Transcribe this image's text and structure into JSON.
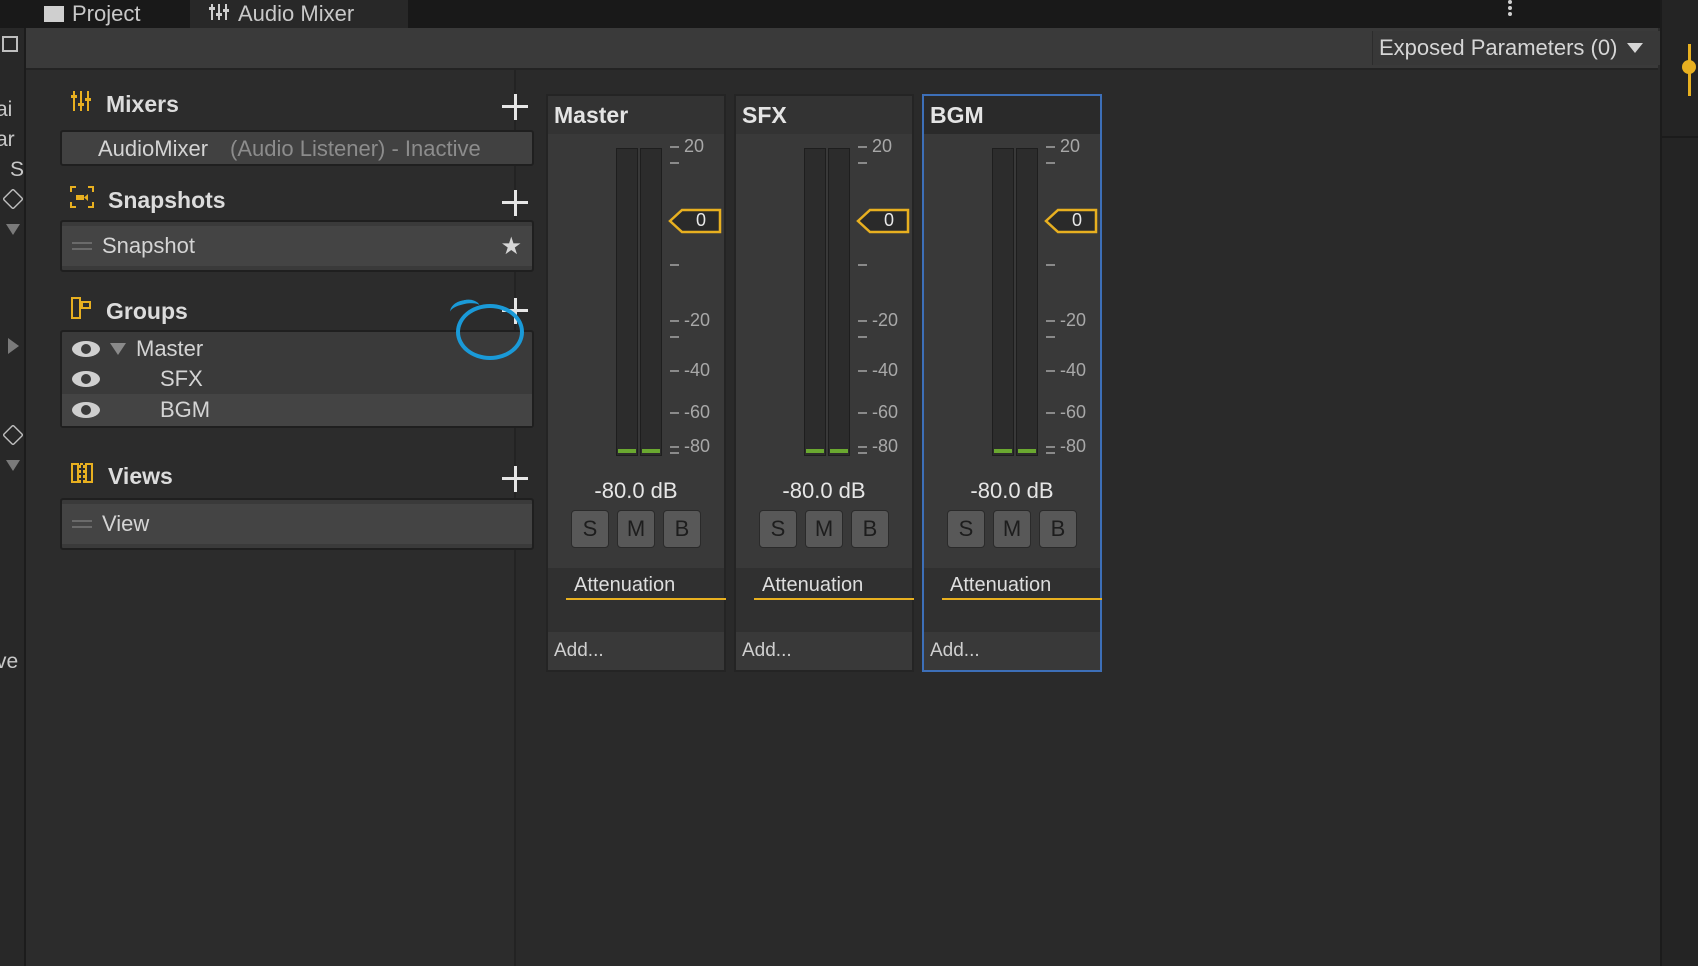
{
  "tabs": {
    "project": "Project",
    "mixer": "Audio Mixer"
  },
  "left_strip_fragments": [
    "ai",
    "ar",
    "S",
    "ve"
  ],
  "toolbar": {
    "exposed_parameters": "Exposed Parameters (0)"
  },
  "sections": {
    "mixers": {
      "title": "Mixers",
      "item_name": "AudioMixer",
      "item_status": "(Audio Listener) - Inactive"
    },
    "snapshots": {
      "title": "Snapshots",
      "item": "Snapshot"
    },
    "groups": {
      "title": "Groups",
      "items": [
        "Master",
        "SFX",
        "BGM"
      ]
    },
    "views": {
      "title": "Views",
      "item": "View"
    }
  },
  "scale_labels": [
    "20",
    "-20",
    "-40",
    "-60",
    "-80"
  ],
  "channels": [
    {
      "name": "Master",
      "fader_value": "0",
      "db": "-80.0 dB",
      "solo": "S",
      "mute": "M",
      "bypass": "B",
      "effect": "Attenuation",
      "add": "Add..."
    },
    {
      "name": "SFX",
      "fader_value": "0",
      "db": "-80.0 dB",
      "solo": "S",
      "mute": "M",
      "bypass": "B",
      "effect": "Attenuation",
      "add": "Add..."
    },
    {
      "name": "BGM",
      "fader_value": "0",
      "db": "-80.0 dB",
      "solo": "S",
      "mute": "M",
      "bypass": "B",
      "effect": "Attenuation",
      "add": "Add..."
    }
  ],
  "colors": {
    "accent": "#e8b020",
    "annotation": "#1a9ad8",
    "selection": "#3d6fb8",
    "meter_level": "#6aa830"
  }
}
